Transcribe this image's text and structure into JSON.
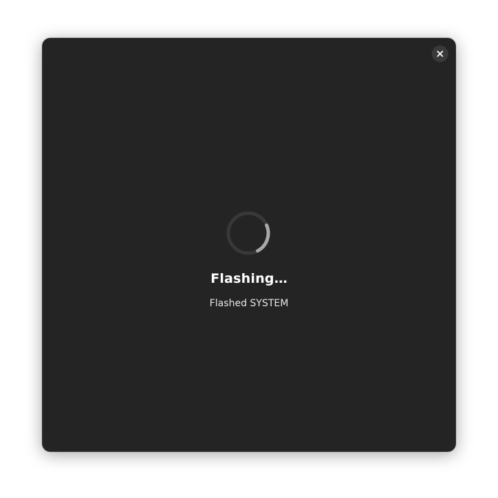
{
  "dialog": {
    "close_icon": "close-icon",
    "spinner_icon": "spinner-icon",
    "title": "Flashing…",
    "subtitle": "Flashed SYSTEM"
  },
  "colors": {
    "background": "#242424",
    "close_button_bg": "#3a3a3a",
    "spinner_track": "#383838",
    "spinner_arc": "#a8a8a8",
    "text": "#ffffff"
  }
}
